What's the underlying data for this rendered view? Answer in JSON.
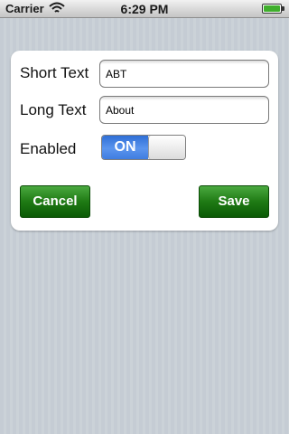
{
  "status_bar": {
    "carrier": "Carrier",
    "time": "6:29 PM",
    "wifi_icon": "wifi-icon",
    "battery_icon": "battery-icon"
  },
  "form": {
    "short_text": {
      "label": "Short Text",
      "value": "ABT"
    },
    "long_text": {
      "label": "Long Text",
      "value": "About"
    },
    "enabled": {
      "label": "Enabled",
      "state_label": "ON",
      "on": true
    }
  },
  "buttons": {
    "cancel": "Cancel",
    "save": "Save"
  },
  "colors": {
    "button_green": "#1f7a14",
    "switch_blue": "#3f7de0",
    "background": "#c5ccd4"
  }
}
